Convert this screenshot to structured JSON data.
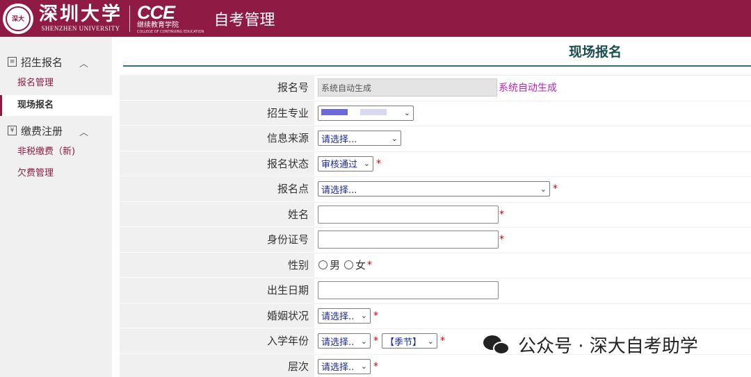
{
  "header": {
    "seal_text": "深大",
    "university_cn": "深圳大学",
    "university_en": "SHENZHEN UNIVERSITY",
    "college_logo": "CCE",
    "college_cn": "继续教育学院",
    "college_en": "COLLEGE OF CONTINUING EDUCATION",
    "app_title": "自考管理"
  },
  "sidebar": {
    "groups": [
      {
        "label": "招生报名",
        "icon": "document-icon",
        "chevron": "︿"
      },
      {
        "label": "缴费注册",
        "icon": "yen-icon",
        "chevron": "︿"
      }
    ],
    "items": [
      {
        "label": "报名管理"
      },
      {
        "label": "现场报名"
      },
      {
        "label": "非税缴费（新)"
      },
      {
        "label": "欠费管理"
      }
    ]
  },
  "page": {
    "title": "现场报名"
  },
  "form": {
    "reg_no": {
      "label": "报名号",
      "value": "系统自动生成",
      "hint": "系统自动生成"
    },
    "major": {
      "label": "招生专业"
    },
    "source": {
      "label": "信息来源",
      "value": "请选择..."
    },
    "status": {
      "label": "报名状态",
      "value": "审核通过"
    },
    "site": {
      "label": "报名点",
      "value": "请选择..."
    },
    "name": {
      "label": "姓名",
      "value": ""
    },
    "id_no": {
      "label": "身份证号",
      "value": ""
    },
    "gender": {
      "label": "性别",
      "male": "男",
      "female": "女"
    },
    "birth": {
      "label": "出生日期",
      "value": ""
    },
    "marital": {
      "label": "婚姻状况",
      "value": "请选择.."
    },
    "enroll": {
      "label": "入学年份",
      "year": "请选择..",
      "season": "【季节】"
    },
    "level": {
      "label": "层次",
      "value": "请选择.."
    },
    "required_mark": "*"
  },
  "watermark": {
    "text": "公众号 · 深大自考助学"
  },
  "colors": {
    "brand": "#8f1b45",
    "title": "#1a4d4d",
    "hint": "#c020c0",
    "required": "#dd0000"
  }
}
